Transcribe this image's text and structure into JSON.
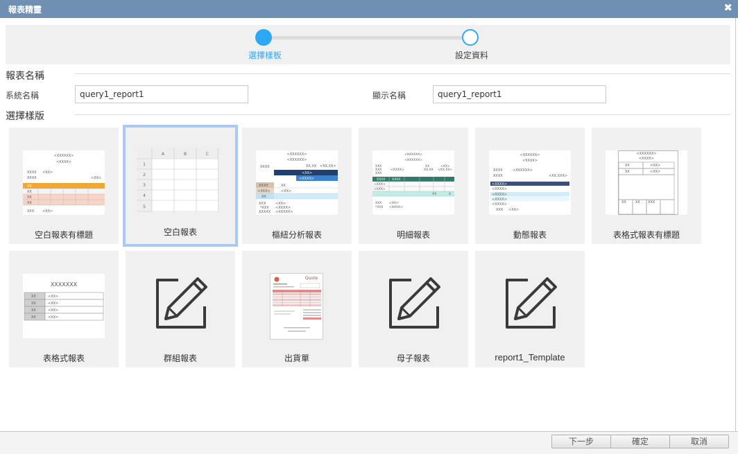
{
  "window": {
    "title": "報表精靈",
    "close_icon": "close-icon"
  },
  "stepper": {
    "steps": [
      {
        "label": "選擇樣板",
        "state": "active"
      },
      {
        "label": "設定資料",
        "state": "inactive"
      }
    ],
    "accent": "#2ea8f2"
  },
  "report_name": {
    "section_title": "報表名稱",
    "system_name_label": "系統名稱",
    "system_name_value": "query1_report1",
    "display_name_label": "顯示名稱",
    "display_name_value": "query1_report1"
  },
  "templates": {
    "section_title": "選擇樣版",
    "selected": "空白報表",
    "items": [
      {
        "label": "空白報表有標題",
        "thumbnail": "titled-blank-report-preview"
      },
      {
        "label": "空白報表",
        "thumbnail": "blank-grid-preview",
        "grid_cols": [
          "A",
          "B",
          "C"
        ],
        "grid_rows": [
          "1",
          "2",
          "3",
          "4",
          "5"
        ]
      },
      {
        "label": "樞紐分析報表",
        "thumbnail": "pivot-report-preview"
      },
      {
        "label": "明細報表",
        "thumbnail": "detail-report-preview"
      },
      {
        "label": "動態報表",
        "thumbnail": "dynamic-report-preview"
      },
      {
        "label": "表格式報表有標題",
        "thumbnail": "titled-table-report-preview"
      },
      {
        "label": "表格式報表",
        "thumbnail": "table-report-preview",
        "preview_title": "XXXXXXX"
      },
      {
        "label": "群組報表",
        "thumbnail": "pencil-edit-icon"
      },
      {
        "label": "出貨單",
        "thumbnail": "quote-invoice-preview",
        "preview_title": "Quote"
      },
      {
        "label": "母子報表",
        "thumbnail": "pencil-edit-icon"
      },
      {
        "label": "report1_Template",
        "thumbnail": "pencil-edit-icon"
      }
    ]
  },
  "footer": {
    "next_label": "下一步",
    "ok_label": "確定",
    "cancel_label": "取消"
  }
}
